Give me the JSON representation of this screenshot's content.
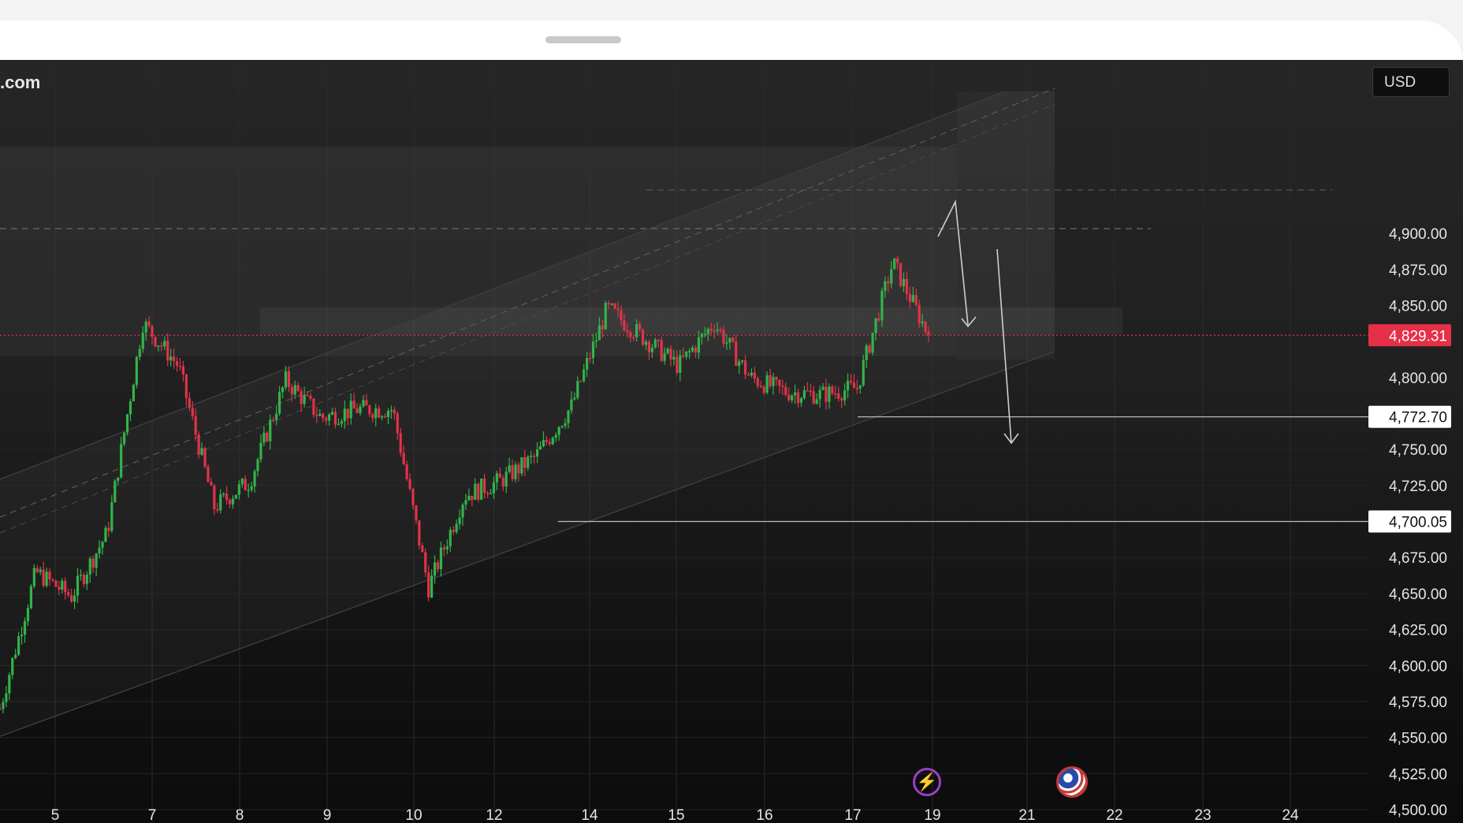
{
  "brand": {
    "text": ".com"
  },
  "currency": {
    "label": "USD"
  },
  "icons": {
    "events": "lightning-event-icon",
    "country": "us-flag-icon"
  },
  "colors": {
    "up": "#33b34a",
    "down": "#e0334a",
    "price_tag": "#e53047"
  },
  "chart_data": {
    "type": "candlestick",
    "symbol_currency": "USD",
    "ylim": [
      4500,
      4912
    ],
    "yticks": [
      "4,900.00",
      "4,875.00",
      "4,850.00",
      "4,800.00",
      "4,750.00",
      "4,725.00",
      "4,675.00",
      "4,650.00",
      "4,625.00",
      "4,600.00",
      "4,575.00",
      "4,550.00",
      "4,525.00",
      "4,500.00"
    ],
    "xticks": [
      "5",
      "7",
      "8",
      "9",
      "10",
      "12",
      "14",
      "15",
      "16",
      "17",
      "19",
      "21",
      "22",
      "23",
      "24"
    ],
    "current_price": {
      "label": "4,829.31",
      "value": 4829.31
    },
    "levels": [
      {
        "label": "4,772.70",
        "value": 4772.7
      },
      {
        "label": "4,700.05",
        "value": 4700.05
      }
    ],
    "projection": "down-arrows-to-levels",
    "ohlc_path": [
      [
        "start",
        4570
      ],
      [
        "5",
        4665
      ],
      [
        "7",
        4648
      ],
      [
        "8-open",
        4692
      ],
      [
        "8",
        4838
      ],
      [
        "8-late",
        4808
      ],
      [
        "9",
        4710
      ],
      [
        "9-late",
        4728
      ],
      [
        "10",
        4798
      ],
      [
        "10-late",
        4772
      ],
      [
        "11",
        4778
      ],
      [
        "12-pre",
        4778
      ],
      [
        "12",
        4654
      ],
      [
        "12-late",
        4718
      ],
      [
        "13",
        4728
      ],
      [
        "14",
        4745
      ],
      [
        "14-late",
        4780
      ],
      [
        "15",
        4848
      ],
      [
        "15-late",
        4828
      ],
      [
        "16",
        4808
      ],
      [
        "16-mid",
        4838
      ],
      [
        "16-late",
        4800
      ],
      [
        "17",
        4790
      ],
      [
        "17-late",
        4788
      ],
      [
        "18",
        4793
      ],
      [
        "18-peak",
        4880
      ],
      [
        "19",
        4829.31
      ]
    ]
  }
}
